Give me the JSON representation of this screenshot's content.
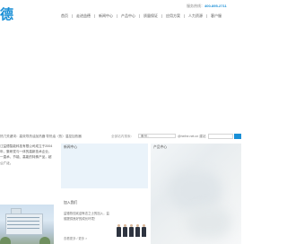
{
  "brand": {
    "logo_text": "德"
  },
  "header": {
    "hotline_label": "服务热线：",
    "hotline_number": "400-895-2711"
  },
  "nav": {
    "items": [
      {
        "label": "首页"
      },
      {
        "label": "走进益德"
      },
      {
        "label": "新闻中心"
      },
      {
        "label": "产品中心"
      },
      {
        "label": "质量保证"
      },
      {
        "label": "应用方案"
      },
      {
        "label": "人力资源"
      },
      {
        "label": "客户服"
      }
    ]
  },
  "search": {
    "keywords_text": "热门关键词：高效导热油加热器  导热油（热）温控加热器",
    "hint": "全部站内搜索：",
    "input_value": "备号：",
    "icp_text": "@heihe.net.cn 建站",
    "field_value": ""
  },
  "intro": {
    "text": "江益德智能科技有限公司成立于2004年，集研发与一体的高新技术企业，一直术、节能、高能的特殊产品，超公广泛。"
  },
  "news": {
    "title": "新闻中心"
  },
  "products": {
    "title": "产品中心"
  },
  "join": {
    "title": "加入我们",
    "text": "益德热忱欢迎有志之士的加入，益德提供良好的成长环境！",
    "more": "查看更多 / 更多 >"
  }
}
